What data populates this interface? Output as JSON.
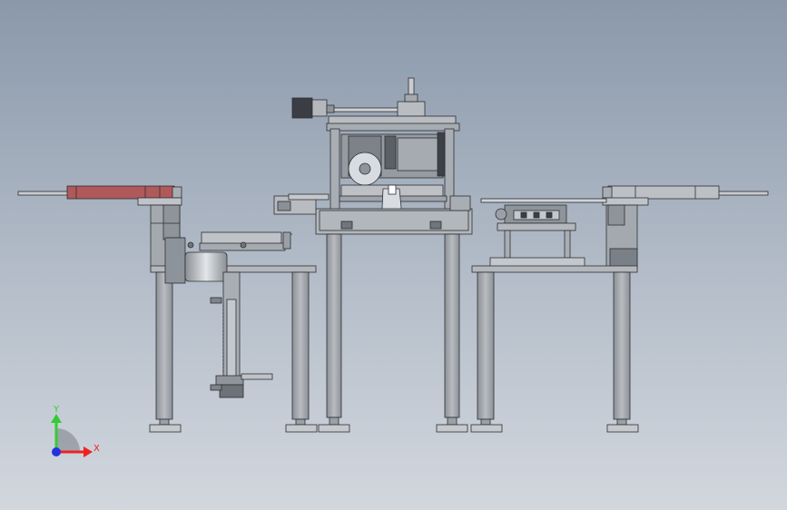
{
  "viewport": {
    "background_top": "#8a98aa",
    "background_bottom": "#d2d7de"
  },
  "triad": {
    "y_label": "Y",
    "x_label": "X",
    "y_color": "#33cc33",
    "x_color": "#ee2222",
    "z_color": "#2233dd"
  },
  "colors": {
    "steel": "#a9aeb4",
    "steel_dark": "#7e848b",
    "outline": "#2c2f33",
    "accent_red": "#b0595a",
    "motor": "#3a3d44",
    "platen": "#d9dce0"
  }
}
